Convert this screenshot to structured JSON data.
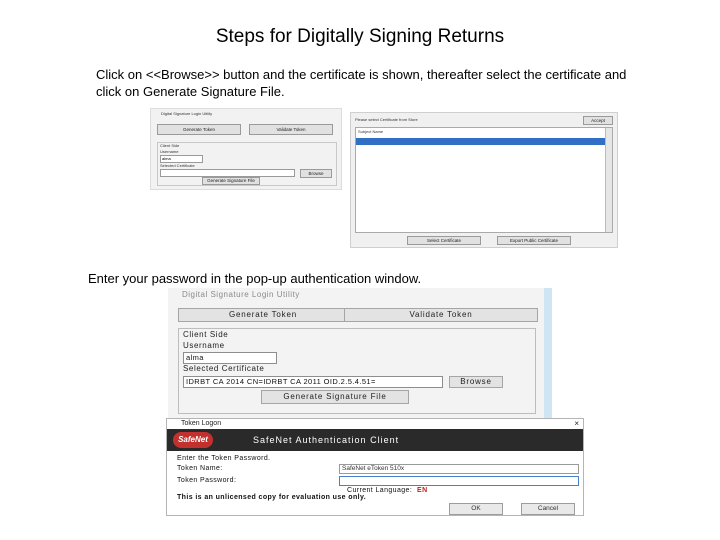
{
  "slide": {
    "title": "Steps for Digitally Signing Returns",
    "step1_line1": "Click on <<Browse>> button and the certificate is shown, thereafter select the certificate and",
    "step1_line2": "click on Generate Signature File.",
    "step2": "Enter your password in the pop-up authentication window."
  },
  "shot1": {
    "window_title": "Digital Signature Login Utility",
    "generate_token": "Generate Token",
    "validate_token": "Validate Token",
    "client_side": "Client Side",
    "username_label": "Username",
    "username_value": "alma",
    "selected_cert_label": "Selected Certificate",
    "browse": "Browse",
    "generate_signature": "Generate Signature File",
    "cert_dialog_title": "Please select Certificate from Store",
    "accept": "Accept",
    "column_name": "Subject Name",
    "select_certificate": "Select Certificate",
    "export_public": "Export Public Certificate"
  },
  "shot2": {
    "window_title": "Digital Signature Login Utility",
    "generate_token": "Generate Token",
    "validate_token": "Validate Token",
    "client_side": "Client Side",
    "username_label": "Username",
    "username_value": "alma",
    "selected_cert_label": "Selected Certificate",
    "selected_cert_value": "IDRBT CA 2014 CN=IDRBT CA 2011 OID.2.5.4.51=",
    "browse": "Browse",
    "generate_signature": "Generate Signature File"
  },
  "token_dialog": {
    "title": "Token Logon",
    "brand": "SafeNet",
    "banner": "SafeNet Authentication Client",
    "prompt": "Enter the Token Password.",
    "token_name_label": "Token Name:",
    "token_name_value": "SafeNet eToken 510x",
    "password_label": "Token Password:",
    "password_value": "",
    "language_label": "Current Language:",
    "language_value": "EN",
    "notice": "This is an unlicensed copy for evaluation use only.",
    "ok": "OK",
    "cancel": "Cancel",
    "close": "×"
  },
  "colors": {
    "selection": "#2f6fc4",
    "banner": "#2a2a2a",
    "logo": "#c2312e",
    "language": "#c0221d"
  }
}
